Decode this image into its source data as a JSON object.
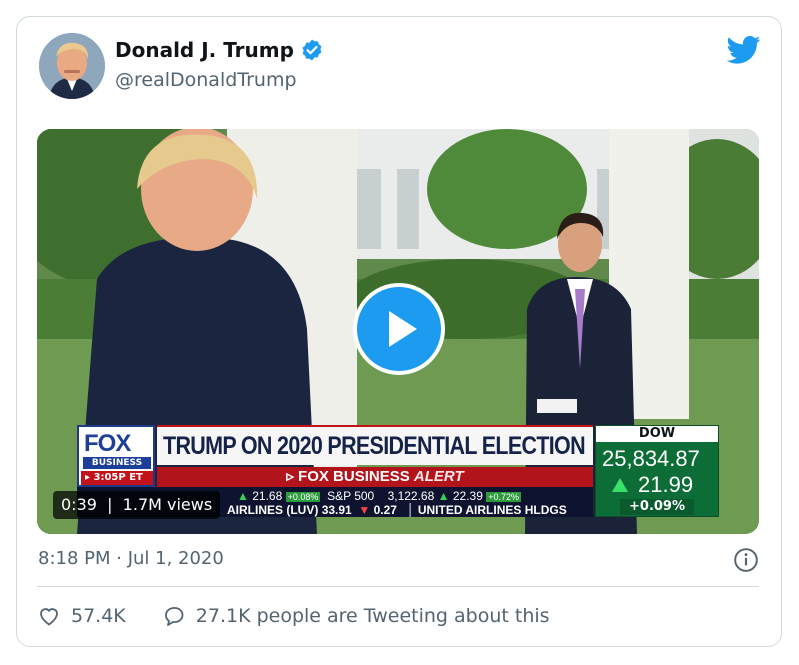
{
  "tweet": {
    "author_name": "Donald J. Trump",
    "handle": "@realDonaldTrump",
    "timestamp": "8:18 PM · Jul 1, 2020"
  },
  "video": {
    "duration": "0:39",
    "views": "1.7M views",
    "broadcast": {
      "network_logo": "FOX",
      "network_sub": "BUSINESS",
      "time": "3:05P ET",
      "headline": "TRUMP ON 2020 PRESIDENTIAL ELECTION",
      "alert_prefix": "FOX BUSINESS",
      "alert_word": "ALERT",
      "ticker_row1": {
        "change1": "21.68",
        "pct1": "+0.08%",
        "index": "S&P 500",
        "index_value": "3,122.68",
        "change2": "22.39",
        "pct2": "+0.72%"
      },
      "ticker_row2": {
        "left": "AIRLINES (LUV)",
        "value": "33.91",
        "change": "0.27",
        "company": "UNITED AIRLINES HLDGS"
      },
      "dow": {
        "label": "DOW",
        "value": "25,834.87",
        "change": "21.99",
        "percent": "+0.09%"
      }
    }
  },
  "engagement": {
    "likes": "57.4K",
    "tweeting": "27.1K people are Tweeting about this"
  },
  "colors": {
    "accent": "#1d9bf0",
    "secondary_text": "#536471",
    "fox_red": "#c4121a",
    "dow_green": "#0d6d37"
  }
}
